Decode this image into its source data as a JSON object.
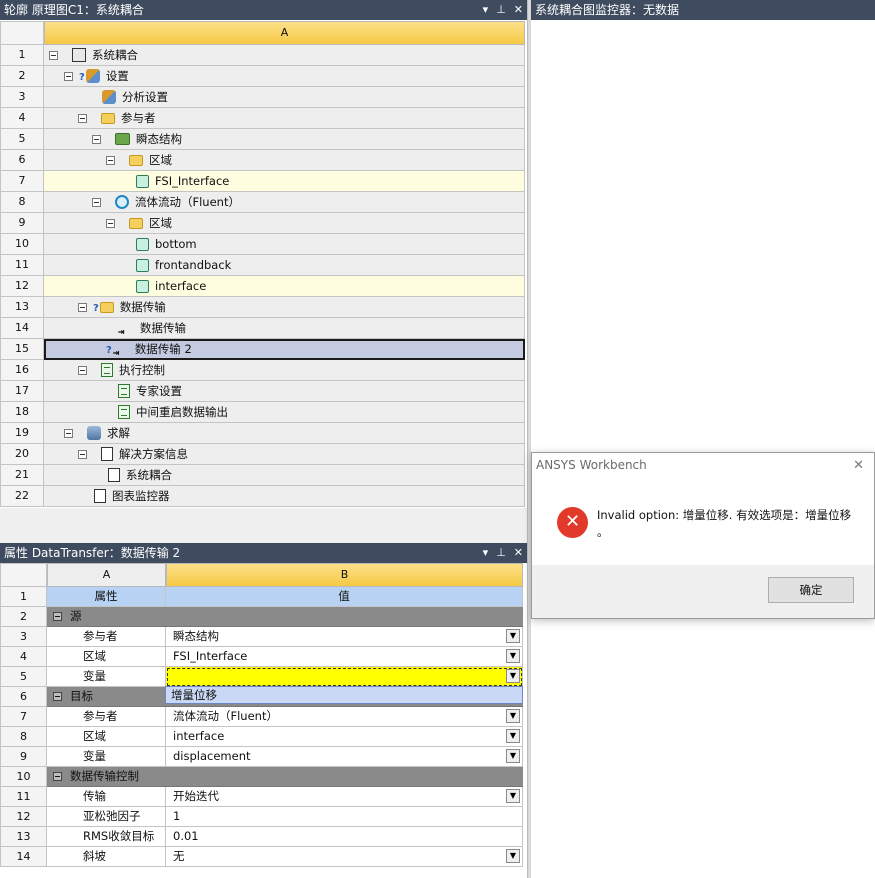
{
  "outline": {
    "title": "轮廓 原理图C1：系统耦合",
    "column_header": "A",
    "rows": [
      {
        "num": "1",
        "label": "系统耦合"
      },
      {
        "num": "2",
        "label": "设置"
      },
      {
        "num": "3",
        "label": "分析设置"
      },
      {
        "num": "4",
        "label": "参与者"
      },
      {
        "num": "5",
        "label": "瞬态结构"
      },
      {
        "num": "6",
        "label": "区域"
      },
      {
        "num": "7",
        "label": "FSI_Interface"
      },
      {
        "num": "8",
        "label": "流体流动（Fluent）"
      },
      {
        "num": "9",
        "label": "区域"
      },
      {
        "num": "10",
        "label": "bottom"
      },
      {
        "num": "11",
        "label": "frontandback"
      },
      {
        "num": "12",
        "label": "interface"
      },
      {
        "num": "13",
        "label": "数据传输"
      },
      {
        "num": "14",
        "label": "数据传输"
      },
      {
        "num": "15",
        "label": "数据传输 2"
      },
      {
        "num": "16",
        "label": "执行控制"
      },
      {
        "num": "17",
        "label": "专家设置"
      },
      {
        "num": "18",
        "label": "中间重启数据输出"
      },
      {
        "num": "19",
        "label": "求解"
      },
      {
        "num": "20",
        "label": "解决方案信息"
      },
      {
        "num": "21",
        "label": "系统耦合"
      },
      {
        "num": "22",
        "label": "图表监控器"
      }
    ],
    "question_mark": "?"
  },
  "monitor": {
    "title": "系统耦合图监控器：无数据"
  },
  "titlebar_buttons": {
    "dropdown": "▾",
    "pin": "⊥",
    "close": "✕"
  },
  "properties": {
    "title": "属性 DataTransfer：数据传输 2",
    "col_a": "A",
    "col_b": "B",
    "header_a": "属性",
    "header_b": "值",
    "rows": [
      {
        "num": "1"
      },
      {
        "num": "2",
        "group": "源"
      },
      {
        "num": "3",
        "name": "参与者",
        "value": "瞬态结构"
      },
      {
        "num": "4",
        "name": "区域",
        "value": "FSI_Interface"
      },
      {
        "num": "5",
        "name": "变量",
        "value": ""
      },
      {
        "num": "6",
        "group": "目标"
      },
      {
        "num": "7",
        "name": "参与者",
        "value": "流体流动（Fluent）"
      },
      {
        "num": "8",
        "name": "区域",
        "value": "interface"
      },
      {
        "num": "9",
        "name": "变量",
        "value": "displacement"
      },
      {
        "num": "10",
        "group": "数据传输控制"
      },
      {
        "num": "11",
        "name": "传输",
        "value": "开始迭代"
      },
      {
        "num": "12",
        "name": "亚松弛因子",
        "value": "1"
      },
      {
        "num": "13",
        "name": "RMS收敛目标",
        "value": "0.01"
      },
      {
        "num": "14",
        "name": "斜坡",
        "value": "无"
      }
    ],
    "dropdown_option": "增量位移",
    "dropdown_arrow": "▼"
  },
  "dialog": {
    "title": "ANSYS Workbench",
    "message_line1": "Invalid option: 增量位移. 有效选项是：增量位移",
    "message_line2": "。",
    "ok_label": "确定",
    "close_glyph": "✕",
    "error_glyph": "✕"
  },
  "colors": {
    "titlebar": "#3f4c60",
    "header_gold": "#f6c944",
    "selected_row": "#c4cbe0",
    "yellow_edit": "#ffff00",
    "error_red": "#e23a2a"
  }
}
